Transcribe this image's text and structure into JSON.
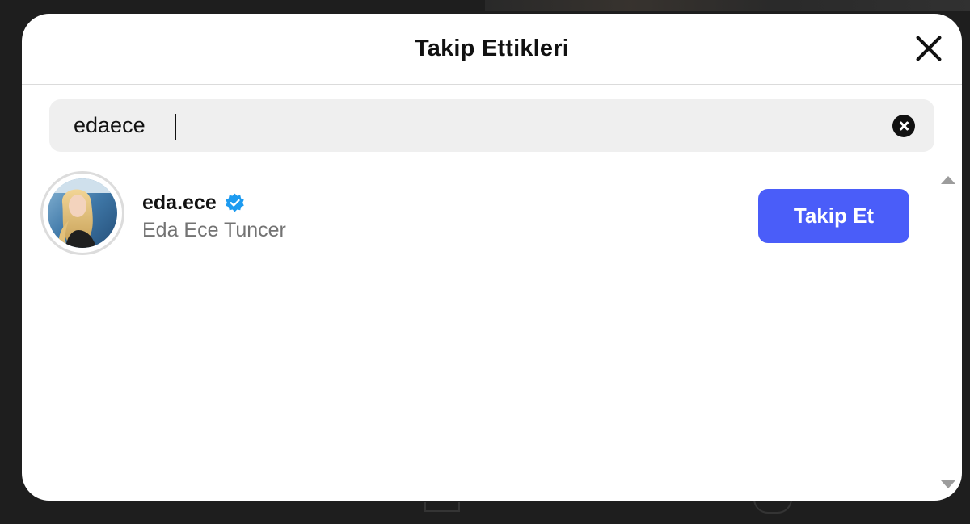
{
  "modal": {
    "title": "Takip Ettikleri"
  },
  "search": {
    "value": "edaece"
  },
  "results": [
    {
      "username": "eda.ece",
      "verified": true,
      "full_name": "Eda Ece Tuncer",
      "action_label": "Takip Et"
    }
  ],
  "colors": {
    "follow_button": "#4a5df9",
    "verified_badge": "#1d9bf0",
    "search_bg": "#efefef"
  },
  "icons": {
    "close": "close-icon",
    "clear_search": "clear-search-icon",
    "verified": "verified-badge-icon",
    "scroll_up": "scroll-up-arrow-icon",
    "scroll_down": "scroll-down-arrow-icon"
  }
}
